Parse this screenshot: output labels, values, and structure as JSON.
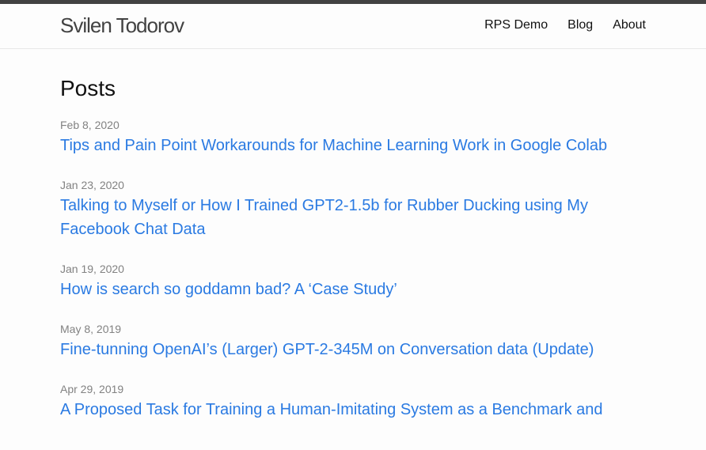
{
  "header": {
    "site_title": "Svilen Todorov",
    "nav": [
      {
        "label": "RPS Demo"
      },
      {
        "label": "Blog"
      },
      {
        "label": "About"
      }
    ]
  },
  "main": {
    "heading": "Posts",
    "posts": [
      {
        "date": "Feb 8, 2020",
        "title": "Tips and Pain Point Workarounds for Machine Learning Work in Google Colab"
      },
      {
        "date": "Jan 23, 2020",
        "title": "Talking to Myself or How I Trained GPT2-1.5b for Rubber Ducking using My Facebook Chat Data"
      },
      {
        "date": "Jan 19, 2020",
        "title": "How is search so goddamn bad? A ‘Case Study’"
      },
      {
        "date": "May 8, 2019",
        "title": "Fine-tunning OpenAI’s (Larger) GPT-2-345M on Conversation data (Update)"
      },
      {
        "date": "Apr 29, 2019",
        "title": "A Proposed Task for Training a Human-Imitating System as a Benchmark and"
      }
    ]
  },
  "colors": {
    "link": "#2a7ae2",
    "meta": "#828282",
    "top_border": "#424242",
    "background": "#fdfdfd"
  }
}
